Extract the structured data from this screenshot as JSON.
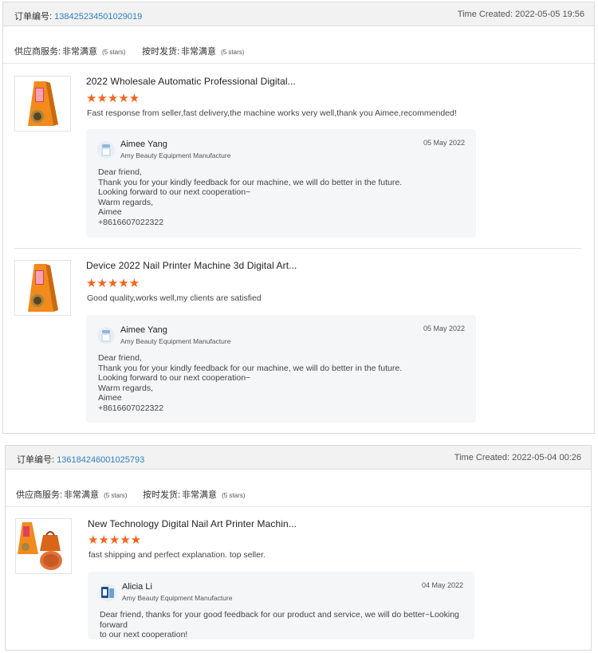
{
  "orders": [
    {
      "order_label": "订单编号:",
      "order_number": "138425234501029019",
      "time_created": "Time Created: 2022-05-05 19:56",
      "supplier_service_label": "供应商服务:",
      "supplier_service_value": "非常满意",
      "supplier_service_stars": "(5 stars)",
      "shipping_label": "按时发货:",
      "shipping_value": "非常满意",
      "shipping_stars": "(5 stars)",
      "reviews": [
        {
          "title": "2022 Wholesale Automatic Professional Digital...",
          "stars": "★★★★★",
          "rating": 5,
          "comment": "Fast response from seller,fast delivery,the machine works very well,thank you Aimee,recommended!",
          "reply": {
            "name": "Aimee Yang",
            "company": "Amy Beauty Equipment Manufacture",
            "date": "05 May 2022",
            "text": "Dear friend,\nThank you for your kindly feedback for our machine, we will do better in the future.\nLooking forward to our next cooperation~\nWarm regards,\nAimee\n+8616607022322"
          }
        },
        {
          "title": "Device 2022 Nail Printer Machine 3d Digital Art...",
          "stars": "★★★★★",
          "rating": 5,
          "comment": "Good quality,works well,my clients are satisfied",
          "reply": {
            "name": "Aimee Yang",
            "company": "Amy Beauty Equipment Manufacture",
            "date": "05 May 2022",
            "text": "Dear friend,\nThank you for your kindly feedback for our machine, we will do better in the future.\nLooking forward to our next cooperation~\nWarm regards,\nAimee\n+8616607022322"
          }
        }
      ]
    },
    {
      "order_label": "订单编号:",
      "order_number": "136184246001025793",
      "time_created": "Time Created: 2022-05-04 00:26",
      "supplier_service_label": "供应商服务:",
      "supplier_service_value": "非常满意",
      "supplier_service_stars": "(5 stars)",
      "shipping_label": "按时发货:",
      "shipping_value": "非常满意",
      "shipping_stars": "(5 stars)",
      "reviews": [
        {
          "title": "New Technology Digital Nail Art Printer Machin...",
          "stars": "★★★★★",
          "rating": 5,
          "comment": "fast shipping and perfect explanation. top seller.",
          "reply": {
            "name": "Alicia Li",
            "company": "Amy Beauty Equipment Manufacture",
            "date": "04 May 2022",
            "text": "Dear friend, thanks for your good feedback for our product and service, we will do better~Looking forward\nto our next cooperation!"
          }
        }
      ]
    }
  ]
}
